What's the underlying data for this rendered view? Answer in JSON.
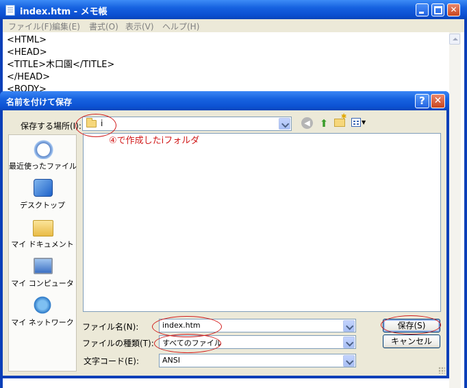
{
  "notepad": {
    "title": "index.htm - メモ帳",
    "menu": [
      "ファイル(F)",
      "編集(E)",
      "書式(O)",
      "表示(V)",
      "ヘルプ(H)"
    ],
    "lines": [
      "<HTML>",
      "<HEAD>",
      "<TITLE>木口園</TITLE>",
      "</HEAD>",
      "<BODY>"
    ],
    "window_buttons": {
      "minimize": "minimize",
      "maximize": "maximize",
      "close": "close"
    }
  },
  "dialog": {
    "title": "名前を付けて保存",
    "help_label": "?",
    "close_label": "✕",
    "save_in_label": "保存する場所(I):",
    "save_in_value": "i",
    "places": [
      {
        "label": "最近使ったファイル",
        "icon": "recent-documents-icon"
      },
      {
        "label": "デスクトップ",
        "icon": "desktop-icon"
      },
      {
        "label": "マイ ドキュメント",
        "icon": "my-documents-icon"
      },
      {
        "label": "マイ コンピュータ",
        "icon": "my-computer-icon"
      },
      {
        "label": "マイ ネットワーク",
        "icon": "my-network-icon"
      }
    ],
    "file_name_label": "ファイル名(N):",
    "file_name_value": "index.htm",
    "file_type_label": "ファイルの種類(T):",
    "file_type_value": "すべてのファイル",
    "encoding_label": "文字コード(E):",
    "encoding_value": "ANSI",
    "save_button": "保存(S)",
    "cancel_button": "キャンセル",
    "toolbar": {
      "back": "back-arrow-icon",
      "up": "up-folder-icon",
      "new_folder": "new-folder-icon",
      "views": "views-menu-icon"
    }
  },
  "annotation": {
    "text": "④で作成したiフォルダ",
    "color": "#d11a1a"
  },
  "colors": {
    "xp_title_blue": "#0b52d3",
    "dialog_face": "#ece9d8",
    "close_red": "#c9461f"
  }
}
